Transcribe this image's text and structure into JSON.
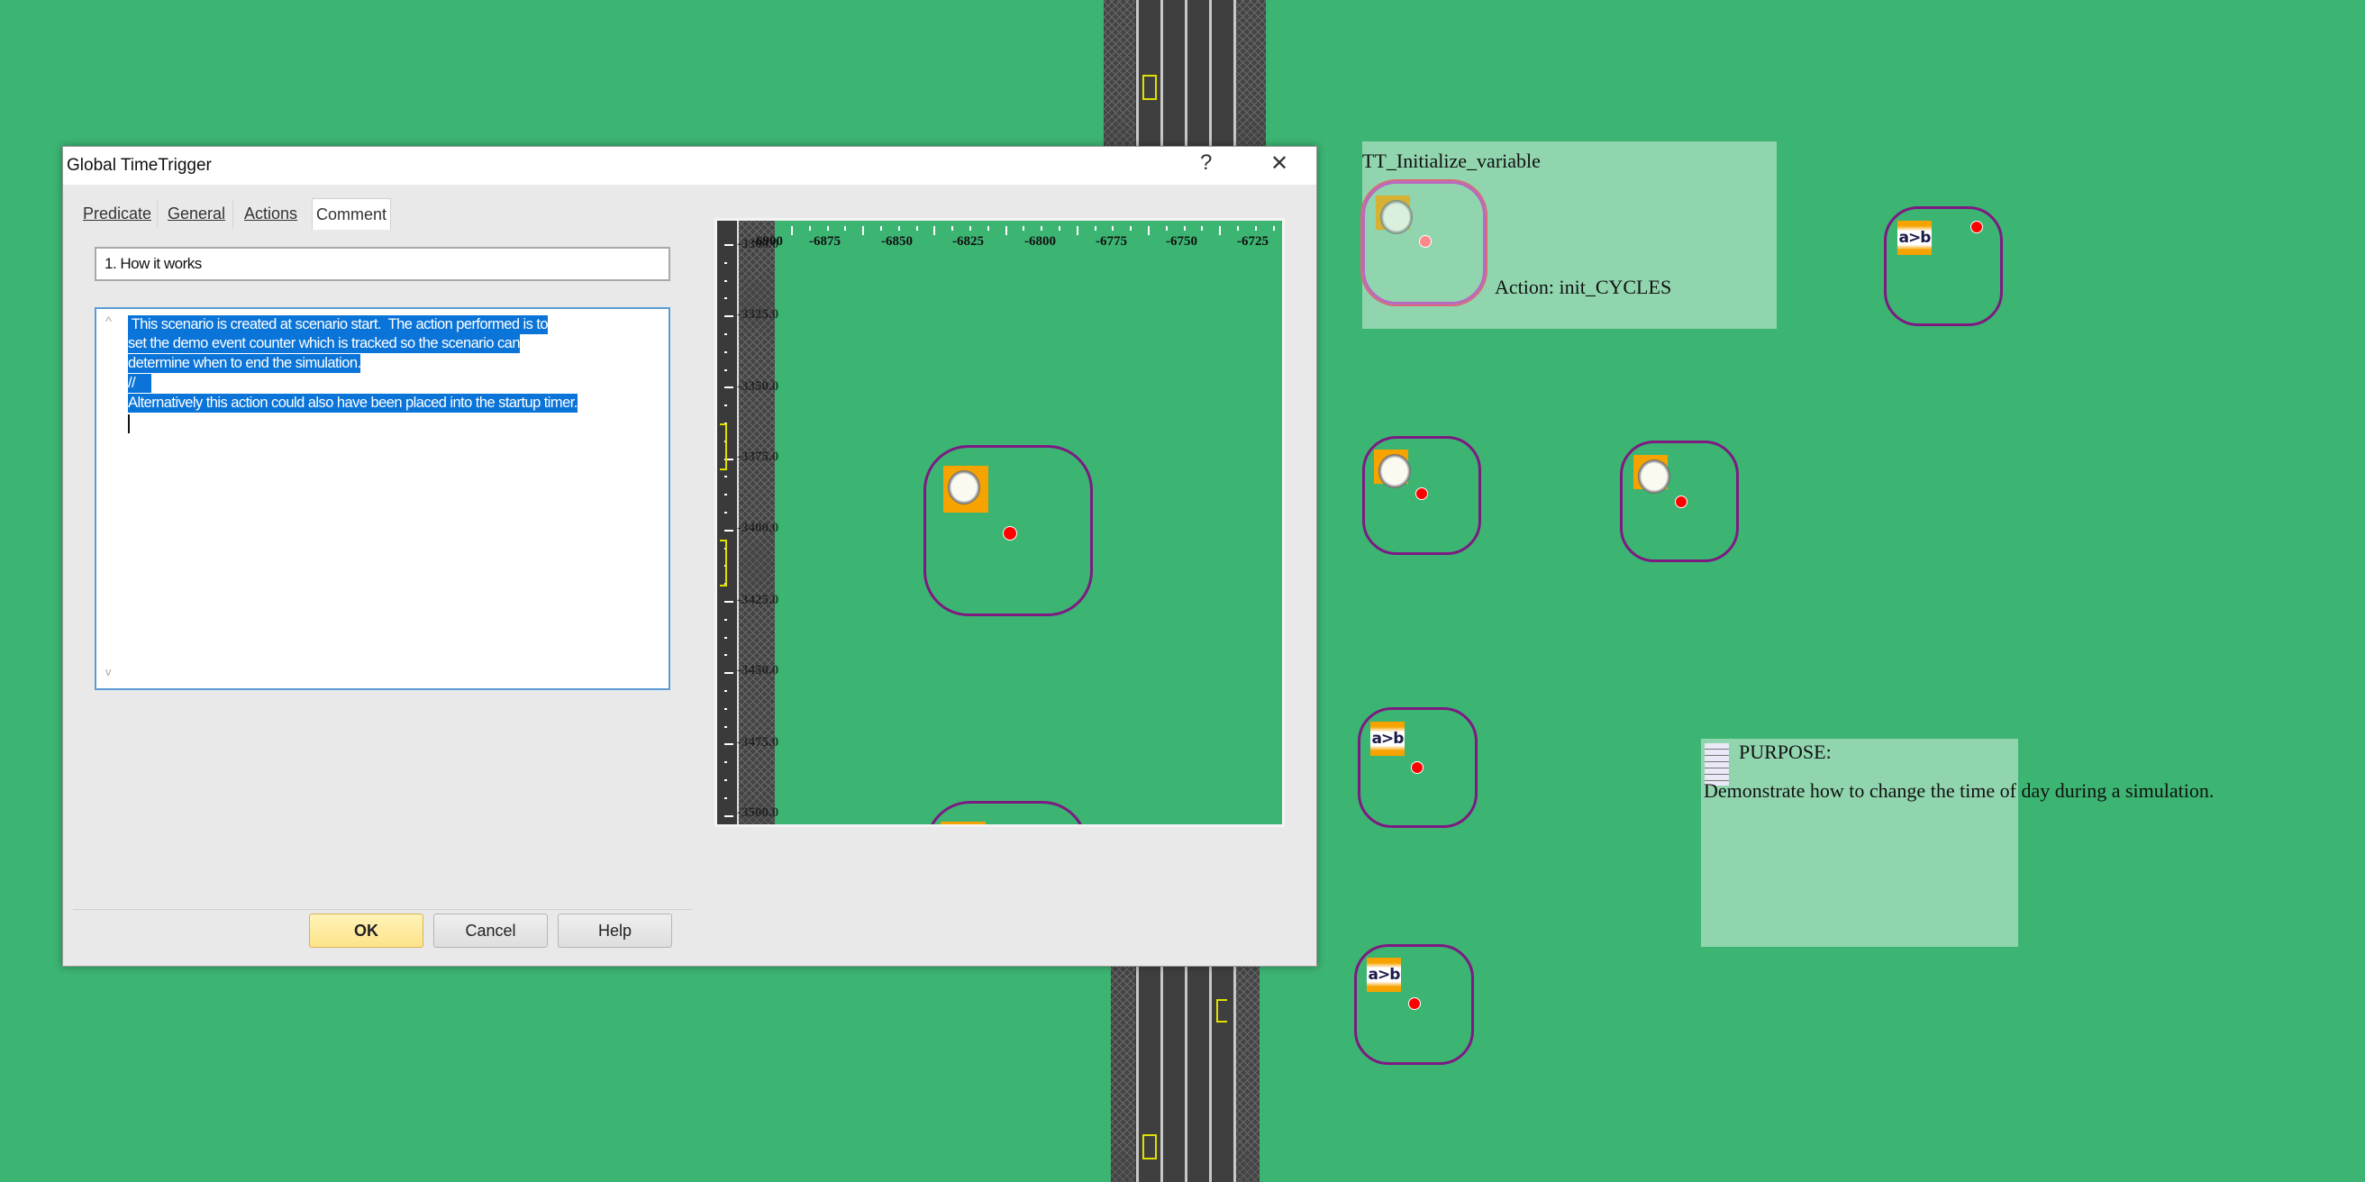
{
  "dialog": {
    "title": "Global TimeTrigger",
    "help_glyph": "?",
    "close_glyph": "✕",
    "tabs": [
      {
        "label": "Predicate",
        "active": false
      },
      {
        "label": "General",
        "active": false
      },
      {
        "label": "Actions",
        "active": false
      },
      {
        "label": "Comment",
        "active": true
      }
    ],
    "subject_value": "1. How it works",
    "comment_lines": [
      " This scenario is created at scenario start.  The action performed is to",
      "set the demo event counter which is tracked so the scenario can",
      "determine when to end the simulation.",
      "//",
      "Alternatively this action could also have been placed into the startup timer."
    ],
    "scroll_up_glyph": "^",
    "scroll_down_glyph": "v",
    "buttons": {
      "ok": "OK",
      "cancel": "Cancel",
      "help": "Help"
    },
    "preview": {
      "x_ticks": [
        "-6900",
        "-6875",
        "-6850",
        "-6825",
        "-6800",
        "-6775",
        "-6750",
        "-6725"
      ],
      "y_ticks": [
        "-3300.0",
        "-3325.0",
        "-3350.0",
        "-3375.0",
        "-3400.0",
        "-3425.0",
        "-3450.0",
        "-3475.0",
        "-3500.0"
      ]
    }
  },
  "canvas": {
    "tt_group": {
      "title": "TT_Initialize_variable",
      "action": "Action: init_CYCLES"
    },
    "compare_label": "a>b",
    "purpose": {
      "title": "PURPOSE:",
      "text": "Demonstrate how to change the time of day during a simulation."
    },
    "colors": {
      "background": "#3cb472",
      "node_border": "#7d1a82",
      "icon_bg": "#f6a300",
      "selection": "#0a74d8"
    }
  }
}
